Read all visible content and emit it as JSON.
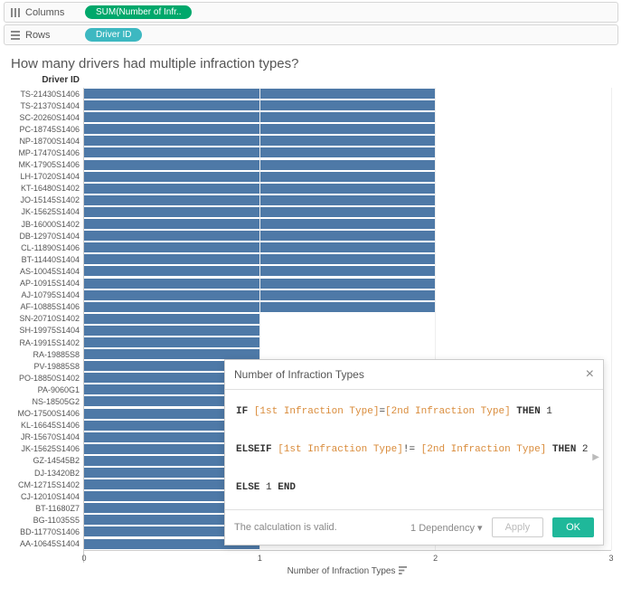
{
  "shelves": {
    "columns_label": "Columns",
    "rows_label": "Rows",
    "columns_pill": "SUM(Number of Infr..",
    "rows_pill": "Driver ID"
  },
  "chart_title": "How many drivers had multiple infraction types?",
  "yaxis_title": "Driver ID",
  "xaxis_label": "Number of Infraction Types",
  "x_ticks": [
    "0",
    "1",
    "2",
    "3"
  ],
  "chart_data": {
    "type": "bar",
    "orientation": "horizontal",
    "title": "How many drivers had multiple infraction types?",
    "xlabel": "Number of Infraction Types",
    "ylabel": "Driver ID",
    "xlim": [
      0,
      3
    ],
    "categories": [
      "TS-21430S1406",
      "TS-21370S1404",
      "SC-20260S1404",
      "PC-18745S1406",
      "NP-18700S1404",
      "MP-17470S1406",
      "MK-17905S1406",
      "LH-17020S1404",
      "KT-16480S1402",
      "JO-15145S1402",
      "JK-15625S1404",
      "JB-16000S1402",
      "DB-12970S1404",
      "CL-11890S1406",
      "BT-11440S1404",
      "AS-10045S1404",
      "AP-10915S1404",
      "AJ-10795S1404",
      "AF-10885S1406",
      "SN-20710S1402",
      "SH-19975S1404",
      "RA-19915S1402",
      "RA-19885S8",
      "PV-19885S8",
      "PO-18850S1402",
      "PA-9060G1",
      "NS-18505G2",
      "MO-17500S1406",
      "KL-16645S1406",
      "JR-15670S1404",
      "JK-15625S1406",
      "GZ-14545B2",
      "DJ-13420B2",
      "CM-12715S1402",
      "CJ-12010S1404",
      "BT-11680Z7",
      "BG-11035S5",
      "BD-11770S1406",
      "AA-10645S1404"
    ],
    "values": [
      2,
      2,
      2,
      2,
      2,
      2,
      2,
      2,
      2,
      2,
      2,
      2,
      2,
      2,
      2,
      2,
      2,
      2,
      2,
      1,
      1,
      1,
      1,
      1,
      1,
      1,
      1,
      1,
      1,
      1,
      1,
      1,
      1,
      1,
      1,
      1,
      1,
      1,
      1
    ]
  },
  "calc_editor": {
    "title": "Number of Infraction Types",
    "status": "The calculation is valid.",
    "dependency": "1 Dependency",
    "apply": "Apply",
    "ok": "OK",
    "formula": {
      "line1_kw1": "IF",
      "line1_f1": "[1st Infraction Type]",
      "line1_eq": "=",
      "line1_f2": "[2nd Infraction Type]",
      "line1_kw2": "THEN",
      "line1_v": "1",
      "line2_kw1": "ELSEIF",
      "line2_f1": "[1st Infraction Type]",
      "line2_ne": "!=",
      "line2_f2": "[2nd Infraction Type]",
      "line2_kw2": "THEN",
      "line2_v": "2",
      "line3_kw1": "ELSE",
      "line3_v": "1",
      "line3_kw2": "END"
    }
  }
}
